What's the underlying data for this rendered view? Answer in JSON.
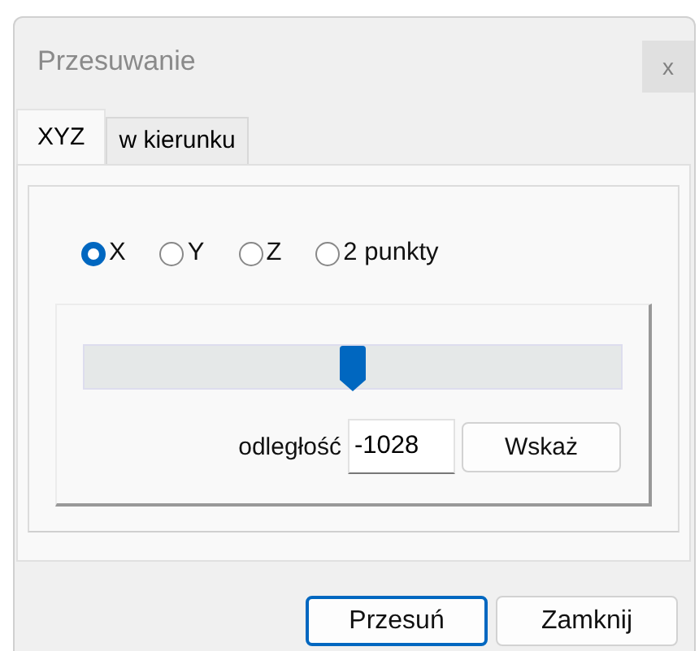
{
  "window": {
    "title": "Przesuwanie",
    "close": "x"
  },
  "tabs": [
    {
      "label": "XYZ",
      "selected": true
    },
    {
      "label": "w kierunku",
      "selected": false
    }
  ],
  "axes": [
    {
      "label": "X",
      "selected": true
    },
    {
      "label": "Y",
      "selected": false
    },
    {
      "label": "Z",
      "selected": false
    },
    {
      "label": "2 punkty",
      "selected": false
    }
  ],
  "slider": {
    "level": 0.5
  },
  "distance": {
    "label": "odległość",
    "value": "-1028",
    "button": "Wskaż"
  },
  "buttons": [
    {
      "label": "Przesuń",
      "default": true
    },
    {
      "label": "Zamknij",
      "default": false
    }
  ]
}
